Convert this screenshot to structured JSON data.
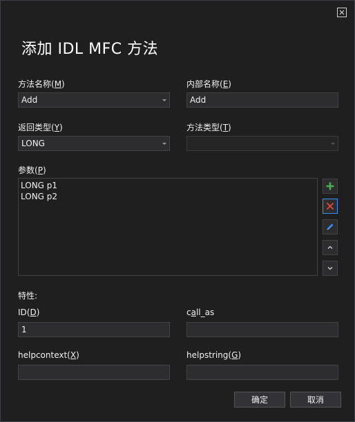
{
  "dialog": {
    "title": "添加 IDL MFC 方法",
    "ok_label": "确定",
    "cancel_label": "取消"
  },
  "method_name": {
    "label": "方法名称(",
    "accel": "M",
    "suffix": ")",
    "value": "Add"
  },
  "internal_name": {
    "label": "内部名称(",
    "accel": "E",
    "suffix": ")",
    "value": "Add"
  },
  "return_type": {
    "label": "返回类型(",
    "accel": "Y",
    "suffix": ")",
    "value": "LONG"
  },
  "method_type": {
    "label": "方法类型(",
    "accel": "T",
    "suffix": ")",
    "value": ""
  },
  "params": {
    "label": "参数(",
    "accel": "P",
    "suffix": ")",
    "items": [
      "LONG p1",
      "LONG p2"
    ]
  },
  "attributes": {
    "label": "特性:"
  },
  "id": {
    "label": "ID(",
    "accel": "D",
    "suffix": ")",
    "value": "1"
  },
  "call_as": {
    "label_pre": "c",
    "accel": "a",
    "label_post": "ll_as",
    "value": ""
  },
  "helpcontext": {
    "label": "helpcontext(",
    "accel": "X",
    "suffix": ")",
    "value": ""
  },
  "helpstring": {
    "label": "helpstring(",
    "accel": "G",
    "suffix": ")",
    "value": ""
  },
  "icons": {
    "close": "close-icon",
    "add": "plus-icon",
    "remove": "x-icon",
    "edit": "pencil-icon",
    "up": "chevron-up-icon",
    "down": "chevron-down-icon"
  },
  "colors": {
    "background": "#1f1f1f",
    "field": "#2d2d30",
    "add_green": "#4caf50",
    "remove_red": "#e8453c",
    "edit_blue": "#3794ff"
  }
}
